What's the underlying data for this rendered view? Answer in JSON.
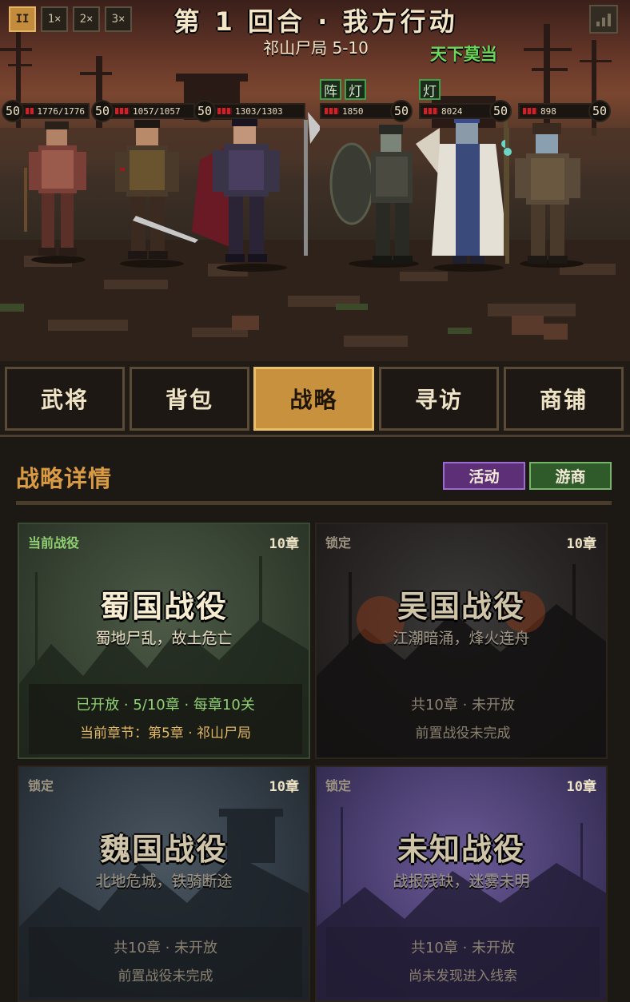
{
  "battle": {
    "speed_buttons": [
      "II",
      "1×",
      "2×",
      "3×"
    ],
    "round_title": "第 1 回合 · 我方行动",
    "stage": "祁山尸局 5-10",
    "enemy_title": "天下莫当",
    "allies": [
      {
        "level": "50",
        "hp": "1776/1776"
      },
      {
        "level": "50",
        "hp": "1057/1057"
      },
      {
        "level": "50",
        "hp": "1303/1303"
      }
    ],
    "enemies": [
      {
        "level": "50",
        "hp": "1850",
        "buffs": [
          "阵",
          "灯"
        ]
      },
      {
        "level": "50",
        "hp": "8024",
        "buffs": [
          "灯"
        ]
      },
      {
        "level": "50",
        "hp": "898",
        "buffs": []
      }
    ],
    "stats_icon": "bar-chart-icon"
  },
  "tabs": [
    {
      "label": "武将",
      "active": false
    },
    {
      "label": "背包",
      "active": false
    },
    {
      "label": "战略",
      "active": true
    },
    {
      "label": "寻访",
      "active": false
    },
    {
      "label": "商铺",
      "active": false
    }
  ],
  "strategy": {
    "title": "战略详情",
    "activity_label": "活动",
    "merchant_label": "游商",
    "campaigns": [
      {
        "tag": "当前战役",
        "chapters": "10章",
        "name": "蜀国战役",
        "desc": "蜀地尸乱，故土危亡",
        "line1": "已开放 · 5/10章 · 每章10关",
        "line2": "当前章节：第5章 · 祁山尸局",
        "locked": false
      },
      {
        "tag": "锁定",
        "chapters": "10章",
        "name": "吴国战役",
        "desc": "江潮暗涌，烽火连舟",
        "line1": "共10章 · 未开放",
        "line2": "前置战役未完成",
        "locked": true
      },
      {
        "tag": "锁定",
        "chapters": "10章",
        "name": "魏国战役",
        "desc": "北地危城，铁骑断途",
        "line1": "共10章 · 未开放",
        "line2": "前置战役未完成",
        "locked": true
      },
      {
        "tag": "锁定",
        "chapters": "10章",
        "name": "未知战役",
        "desc": "战报残缺，迷雾未明",
        "line1": "共10章 · 未开放",
        "line2": "尚未发现进入线索",
        "locked": true
      }
    ]
  },
  "colors": {
    "accent_gold": "#c8913e",
    "title_orange": "#d99a44",
    "activity_purple": "#5c2f76",
    "merchant_green": "#2f5a2a",
    "current_green": "#6bd65a"
  }
}
